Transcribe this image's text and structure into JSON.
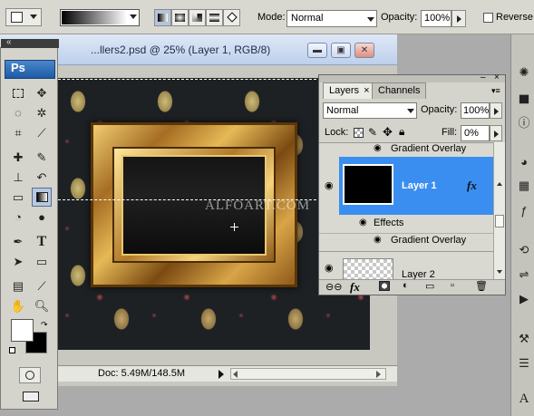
{
  "options_bar": {
    "mode_label": "Mode:",
    "mode_value": "Normal",
    "opacity_label": "Opacity:",
    "opacity_value": "100%",
    "reverse_label": "Reverse"
  },
  "toolbox": {
    "app_badge": "Ps",
    "tools": [
      "marquee",
      "move",
      "lasso",
      "magic-wand",
      "crop",
      "eyedropper",
      "healing-brush",
      "brush",
      "clone-stamp",
      "history-brush",
      "eraser",
      "gradient",
      "blur",
      "dodge",
      "pen",
      "type",
      "path-selection",
      "shape",
      "notes",
      "hand",
      "zoom",
      "quick-mask",
      "screen-mode"
    ]
  },
  "document": {
    "title": "...llers2.psd @ 25% (Layer 1, RGB/8)",
    "watermark": "ALFOART.COM",
    "status": "Doc: 5.49M/148.5M"
  },
  "layers_panel": {
    "tabs": [
      {
        "label": "Layers",
        "active": true
      },
      {
        "label": "Channels",
        "active": false
      }
    ],
    "blend_mode": "Normal",
    "opacity_label": "Opacity:",
    "opacity_value": "100%",
    "lock_label": "Lock:",
    "fill_label": "Fill:",
    "fill_value": "0%",
    "rows": {
      "top_effect": "Gradient Overlay",
      "layer1_name": "Layer 1",
      "fx_symbol": "fx",
      "effects_label": "Effects",
      "gradient_overlay": "Gradient Overlay",
      "layer2_name": "Layer 2"
    },
    "footer_fx": "fx"
  },
  "colors": {
    "selected_layer": "#3a8ef0",
    "panel_bg": "#d4d4cc",
    "window_title": "#bcd0ec"
  }
}
